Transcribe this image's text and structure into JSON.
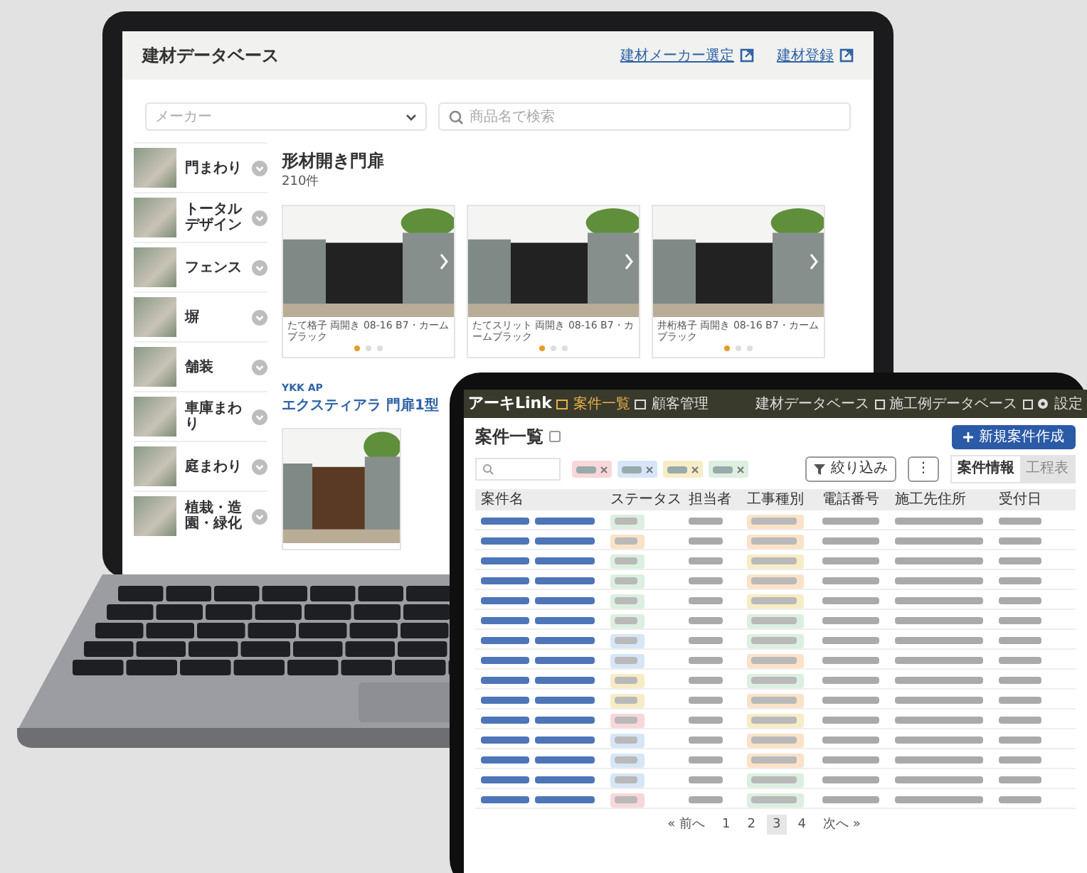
{
  "laptop": {
    "header": {
      "title": "建材データベース",
      "links": [
        "建材メーカー選定",
        "建材登録"
      ]
    },
    "filters": {
      "maker_placeholder": "メーカー",
      "search_placeholder": "商品名で検索"
    },
    "sidebar": {
      "items": [
        {
          "label": "門まわり"
        },
        {
          "label": "トータルデザイン"
        },
        {
          "label": "フェンス"
        },
        {
          "label": "塀"
        },
        {
          "label": "舗装"
        },
        {
          "label": "車庫まわり"
        },
        {
          "label": "庭まわり"
        },
        {
          "label": "植栽・造園・緑化"
        }
      ]
    },
    "category": {
      "title": "形材開き門扉",
      "count": "210件"
    },
    "cards": [
      {
        "caption": "たて格子 両開き 08-16 B7・カームブラック",
        "dots": [
          {
            "selected": true
          },
          {
            "selected": false
          },
          {
            "selected": false
          }
        ]
      },
      {
        "caption": "たてスリット 両開き 08-16 B7・カームブラック",
        "dots": [
          {
            "selected": true
          },
          {
            "selected": false
          },
          {
            "selected": false
          }
        ]
      },
      {
        "caption": "井桁格子 両開き 08-16 B7・カームブラック",
        "dots": [
          {
            "selected": true
          },
          {
            "selected": false
          },
          {
            "selected": false
          }
        ]
      }
    ],
    "product": {
      "maker": "YKK AP",
      "name": "エクスティアラ 門扉1型"
    }
  },
  "tablet": {
    "nav": {
      "brand": "アーキLink",
      "items": [
        {
          "label": "案件一覧",
          "selected": true
        },
        {
          "label": "顧客管理",
          "selected": false
        }
      ],
      "links": [
        "建材データベース",
        "施工例データベース"
      ],
      "settings": "設定"
    },
    "title": "案件一覧",
    "new_button": "新規案件作成",
    "filter_button": "絞り込み",
    "more_button": "⋮",
    "filter_tags": [
      {
        "color": "#f8d7da"
      },
      {
        "color": "#d6e6f7"
      },
      {
        "color": "#f7ecc6"
      },
      {
        "color": "#dcefe0"
      }
    ],
    "view_toggle": [
      {
        "label": "案件情報",
        "selected": true
      },
      {
        "label": "工程表",
        "selected": false
      }
    ],
    "columns": [
      {
        "label": "案件名"
      },
      {
        "label": "ステータス"
      },
      {
        "label": "担当者"
      },
      {
        "label": "工事種別"
      },
      {
        "label": "電話番号"
      },
      {
        "label": "施工先住所"
      },
      {
        "label": "受付日"
      }
    ],
    "rows": [
      {
        "status": {
          "color": "#dcefe0"
        },
        "type": {
          "color": "#fbe2c8"
        }
      },
      {
        "status": {
          "color": "#fbe2c8"
        },
        "type": {
          "color": "#fbe2c8"
        }
      },
      {
        "status": {
          "color": "#dcefe0"
        },
        "type": {
          "color": "#f7ecc6"
        }
      },
      {
        "status": {
          "color": "#dcefe0"
        },
        "type": {
          "color": "#fbe2c8"
        }
      },
      {
        "status": {
          "color": "#dcefe0"
        },
        "type": {
          "color": "#f7ecc6"
        }
      },
      {
        "status": {
          "color": "#dcefe0"
        },
        "type": {
          "color": "#dcefe0"
        }
      },
      {
        "status": {
          "color": "#d6e6f7"
        },
        "type": {
          "color": "#dcefe0"
        }
      },
      {
        "status": {
          "color": "#d6e6f7"
        },
        "type": {
          "color": "#fbe2c8"
        }
      },
      {
        "status": {
          "color": "#f7ecc6"
        },
        "type": {
          "color": "#dcefe0"
        }
      },
      {
        "status": {
          "color": "#f7ecc6"
        },
        "type": {
          "color": "#fbe2c8"
        }
      },
      {
        "status": {
          "color": "#f8d7da"
        },
        "type": {
          "color": "#f7ecc6"
        }
      },
      {
        "status": {
          "color": "#d6e6f7"
        },
        "type": {
          "color": "#fbe2c8"
        }
      },
      {
        "status": {
          "color": "#d6e6f7"
        },
        "type": {
          "color": "#fbe2c8"
        }
      },
      {
        "status": {
          "color": "#d6e6f7"
        },
        "type": {
          "color": "#dcefe0"
        }
      },
      {
        "status": {
          "color": "#f8d7da"
        },
        "type": {
          "color": "#dcefe0"
        }
      }
    ],
    "pagination": [
      {
        "label": "« 前へ",
        "selected": false
      },
      {
        "label": "1",
        "selected": false
      },
      {
        "label": "2",
        "selected": false
      },
      {
        "label": "3",
        "selected": true
      },
      {
        "label": "4",
        "selected": false
      },
      {
        "label": "次へ »",
        "selected": false
      }
    ]
  }
}
